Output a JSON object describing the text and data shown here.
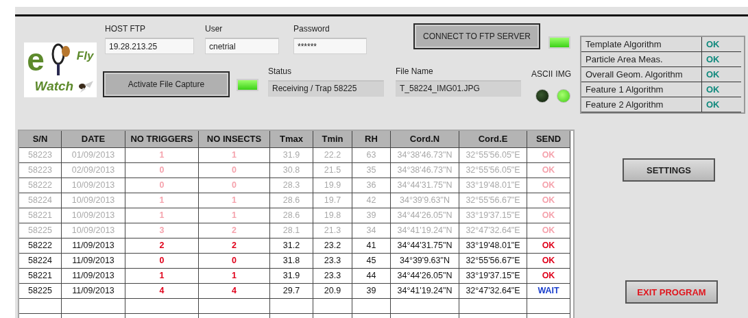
{
  "logo": {
    "text_1": "e",
    "text_2": "Fly",
    "text_3": "Watch"
  },
  "ftp": [
    {
      "label": "HOST FTP",
      "value": "19.28.213.25"
    },
    {
      "label": "User",
      "value": "cnetrial"
    },
    {
      "label": "Password",
      "value": "******"
    }
  ],
  "connect_button": {
    "label": "CONNECT TO FTP SERVER",
    "lamp_on": true
  },
  "capture_button": {
    "label": "Activate File Capture",
    "lamp_on": true
  },
  "status": {
    "label": "Status",
    "value": "Receiving / Trap 58225"
  },
  "file_name": {
    "label": "File Name",
    "value": "T_58224_IMG01.JPG"
  },
  "indicators": [
    {
      "label": "ASCII",
      "on": false
    },
    {
      "label": "IMG",
      "on": true
    }
  ],
  "algorithms": [
    {
      "name": "Template Algorithm",
      "result": "OK"
    },
    {
      "name": "Particle Area Meas.",
      "result": "OK"
    },
    {
      "name": "Overall Geom. Algorithm",
      "result": "OK"
    },
    {
      "name": "Feature 1 Algorithm",
      "result": "OK"
    },
    {
      "name": "Feature 2 Algorithm",
      "result": "OK"
    }
  ],
  "table": {
    "columns": [
      "S/N",
      "DATE",
      "NO TRIGGERS",
      "NO INSECTS",
      "Tmax",
      "Tmin",
      "RH",
      "Cord.N",
      "Cord.E",
      "SEND"
    ],
    "rows": [
      {
        "faded": true,
        "cells": [
          "58223",
          "01/09/2013",
          "1",
          "1",
          "31.9",
          "22.2",
          "63",
          "34°38'46.73\"N",
          "32°55'56.05\"E"
        ],
        "send": {
          "text": "OK",
          "kind": "ok"
        }
      },
      {
        "faded": true,
        "cells": [
          "58223",
          "02/09/2013",
          "0",
          "0",
          "30.8",
          "21.5",
          "35",
          "34°38'46.73\"N",
          "32°55'56.05\"E"
        ],
        "send": {
          "text": "OK",
          "kind": "ok"
        }
      },
      {
        "faded": true,
        "cells": [
          "58222",
          "10/09/2013",
          "0",
          "0",
          "28.3",
          "19.9",
          "36",
          "34°44'31.75\"N",
          "33°19'48.01\"E"
        ],
        "send": {
          "text": "OK",
          "kind": "ok"
        }
      },
      {
        "faded": true,
        "cells": [
          "58224",
          "10/09/2013",
          "1",
          "1",
          "28.6",
          "19.7",
          "42",
          "34°39'9.63\"N",
          "32°55'56.67\"E"
        ],
        "send": {
          "text": "OK",
          "kind": "ok"
        }
      },
      {
        "faded": true,
        "cells": [
          "58221",
          "10/09/2013",
          "1",
          "1",
          "28.6",
          "19.8",
          "39",
          "34°44'26.05\"N",
          "33°19'37.15\"E"
        ],
        "send": {
          "text": "OK",
          "kind": "ok"
        }
      },
      {
        "faded": true,
        "cells": [
          "58225",
          "10/09/2013",
          "3",
          "2",
          "28.1",
          "21.3",
          "34",
          "34°41'19.24\"N",
          "32°47'32.64\"E"
        ],
        "send": {
          "text": "OK",
          "kind": "ok"
        }
      },
      {
        "faded": false,
        "cells": [
          "58222",
          "11/09/2013",
          "2",
          "2",
          "31.2",
          "23.2",
          "41",
          "34°44'31.75\"N",
          "33°19'48.01\"E"
        ],
        "send": {
          "text": "OK",
          "kind": "ok"
        }
      },
      {
        "faded": false,
        "cells": [
          "58224",
          "11/09/2013",
          "0",
          "0",
          "31.8",
          "23.3",
          "45",
          "34°39'9.63\"N",
          "32°55'56.67\"E"
        ],
        "send": {
          "text": "OK",
          "kind": "ok"
        }
      },
      {
        "faded": false,
        "cells": [
          "58221",
          "11/09/2013",
          "1",
          "1",
          "31.9",
          "23.3",
          "44",
          "34°44'26.05\"N",
          "33°19'37.15\"E"
        ],
        "send": {
          "text": "OK",
          "kind": "ok"
        }
      },
      {
        "faded": false,
        "cells": [
          "58225",
          "11/09/2013",
          "4",
          "4",
          "29.7",
          "20.9",
          "39",
          "34°41'19.24\"N",
          "32°47'32.64\"E"
        ],
        "send": {
          "text": "WAIT",
          "kind": "wait"
        }
      }
    ]
  },
  "buttons": {
    "settings": "SETTINGS",
    "exit": "EXIT PROGRAM"
  }
}
